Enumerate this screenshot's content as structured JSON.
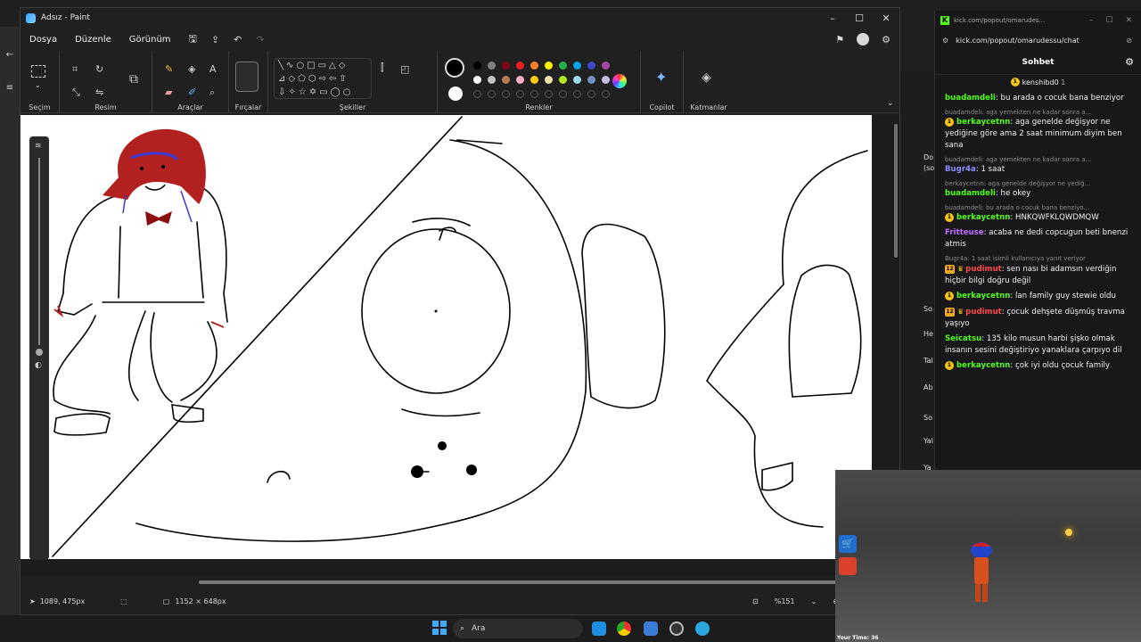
{
  "paint": {
    "title": "Adsız - Paint",
    "window_controls": {
      "minimize": "–",
      "maximize": "☐",
      "close": "✕"
    },
    "menu": {
      "file": "Dosya",
      "edit": "Düzenle",
      "view": "Görünüm"
    },
    "ribbon": {
      "selection": "Seçim",
      "image": "Resim",
      "tools": "Araçlar",
      "brushes": "Fırçalar",
      "shapes": "Şekiller",
      "colors": "Renkler",
      "copilot": "Copilot",
      "layers": "Katmanlar"
    },
    "palette_row1": [
      "#000000",
      "#7f7f7f",
      "#880015",
      "#ed1c24",
      "#ff7f27",
      "#fff200",
      "#22b14c",
      "#00a2e8",
      "#3f48cc",
      "#a349a4"
    ],
    "palette_row2": [
      "#ffffff",
      "#c3c3c3",
      "#b97a57",
      "#ffaec9",
      "#ffc90e",
      "#efe4b0",
      "#b5e61d",
      "#99d9ea",
      "#7092be",
      "#c8bfe7"
    ],
    "status": {
      "cursor_pos": "1089, 475px",
      "canvas_size": "1152 × 648px",
      "zoom": "%151"
    }
  },
  "chat": {
    "url_short": "kick.com/popout/omarudes...",
    "url": "kick.com/popout/omarudessu/chat",
    "header": "Sohbet",
    "pinned_user": "kenshibd0",
    "pinned_count": "1",
    "messages": [
      {
        "user": "buadamdeli",
        "color": "#53fc18",
        "badge": "",
        "reply": "",
        "text": "bu arada o cocuk bana benziyor"
      },
      {
        "user": "berkaycetnn",
        "color": "#53fc18",
        "badge": "1",
        "reply": "buadamdeli: aga yemekten ne kadar sonra a...",
        "text": "aga genelde değişyor ne yediğine göre ama 2 saat minimum diyim ben sana"
      },
      {
        "user": "Bugr4a",
        "color": "#8d8dff",
        "badge": "",
        "reply": "buadamdeli: aga yemekten ne kadar sonra a...",
        "text": "1 saat"
      },
      {
        "user": "buadamdeli",
        "color": "#53fc18",
        "badge": "",
        "reply": "berkaycetnn: aga genelde değişyor ne yediğ...",
        "text": "he okey"
      },
      {
        "user": "berkaycetnn",
        "color": "#53fc18",
        "badge": "1",
        "reply": "buadamdeli: bu arada o cocuk bana benziyo...",
        "text": "HNKQWFKLQWDMQW"
      },
      {
        "user": "Fritteuse",
        "color": "#c06cff",
        "badge": "",
        "reply": "",
        "text": "acaba ne dedi copcugun beti bnenzi atmis"
      },
      {
        "user": "pudimut",
        "color": "#ff4a4a",
        "badge": "12",
        "reply": "Bugr4a: 1 saat isimli kullanıcıya yanıt veriyor",
        "text": "sen nası bi adamsın verdiğin hiçbir bilgi doğru değil"
      },
      {
        "user": "berkaycetnn",
        "color": "#53fc18",
        "badge": "1",
        "reply": "",
        "text": "lan family guy stewie oldu"
      },
      {
        "user": "pudimut",
        "color": "#ff4a4a",
        "badge": "12",
        "reply": "",
        "text": "çocuk dehşete düşmüş travma yaşıyo"
      },
      {
        "user": "Seicatsu",
        "color": "#53fc18",
        "badge": "",
        "reply": "",
        "text": "135 kilo musun harbi şişko olmak insanın sesini değiştiriyo yanaklara çarpıyo dil"
      },
      {
        "user": "berkaycetnn",
        "color": "#53fc18",
        "badge": "1",
        "reply": "",
        "text": "çok iyi oldu çocuk family"
      }
    ]
  },
  "behind_panel": [
    "Do",
    "(so",
    "So",
    "He",
    "Tal",
    "Ab",
    "So",
    "Yal",
    "Ya"
  ],
  "game": {
    "time_label": "Your Time: 36"
  },
  "taskbar": {
    "search_placeholder": "Ara"
  }
}
